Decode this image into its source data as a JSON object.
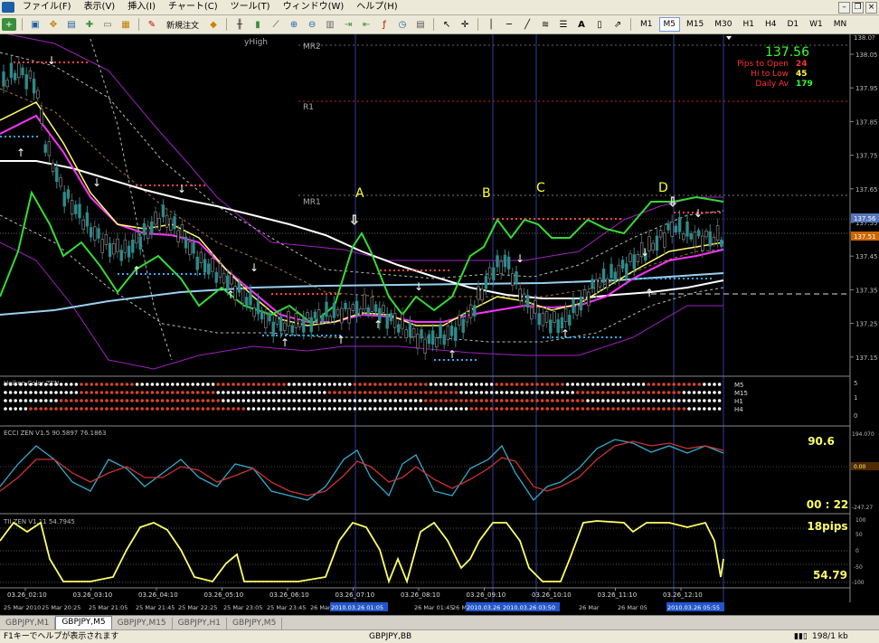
{
  "menu": [
    "ファイル(F)",
    "表示(V)",
    "挿入(I)",
    "チャート(C)",
    "ツール(T)",
    "ウィンドウ(W)",
    "ヘルプ(H)"
  ],
  "toolbar": {
    "new_order_label": "新規注文",
    "timeframes": [
      "M1",
      "M5",
      "M15",
      "M30",
      "H1",
      "H4",
      "D1",
      "W1",
      "MN"
    ],
    "active_timeframe": "M5"
  },
  "main_chart": {
    "yhigh_label": "yHigh",
    "level_labels": {
      "mr2": "MR2",
      "r1": "R1",
      "mr1": "MR1"
    },
    "markers": [
      "A",
      "B",
      "C",
      "D"
    ],
    "price_axis": [
      "138.05",
      "137.95",
      "137.85",
      "137.75",
      "137.65",
      "137.55",
      "137.45",
      "137.35",
      "137.25",
      "137.15"
    ],
    "price_top": "138.0?",
    "badges": {
      "bid": "137.56",
      "current": "137.51"
    },
    "info": {
      "price": "137.56",
      "rows": [
        {
          "label": "Pips to Open",
          "value": "24",
          "label_color": "#ff3333",
          "value_color": "#ff3333"
        },
        {
          "label": "Hi to Low",
          "value": "45",
          "label_color": "#ff3333",
          "value_color": "#ffff33"
        },
        {
          "label": "Daily Av",
          "value": "179",
          "label_color": "#ff3333",
          "value_color": "#33ff33"
        }
      ]
    }
  },
  "heiken": {
    "title": "Heiken Color ZEN",
    "rows": [
      "M5",
      "M15",
      "H1",
      "H4"
    ],
    "axis": [
      "5",
      "1",
      "0"
    ]
  },
  "ecci": {
    "title": "ECCI ZEN V1.5  90.5897 76.1863",
    "value": "90.6",
    "timer": "00 : 22",
    "axis_top": "194.070",
    "axis_mid": "0.00",
    "axis_bottom": "-247.27"
  },
  "tii": {
    "title": "TII ZEN V1.11  54.7945",
    "pips": "18pips",
    "value": "54.79",
    "axis": [
      "100",
      "50",
      "0",
      "-50",
      "-100"
    ]
  },
  "time_axis": {
    "upper": [
      "03.26_02:10",
      "03.26_03:10",
      "03.26_04:10",
      "03.26_05:10",
      "03.26_06:10",
      "03.26_07:10",
      "03.26_08:10",
      "03.26_09:10",
      "03.26_10:10",
      "03.26_11:10",
      "03.26_12:10"
    ],
    "lower": [
      "25 Mar 2010",
      "25 Mar 20:25",
      "25 Mar 21:05",
      "25 Mar 21:45",
      "25 Mar 22:25",
      "25 Mar 23:05",
      "25 Mar 23:45",
      "26 Mar",
      "2010.03.26 01:05",
      "26 Mar 01:45",
      "26 Mar",
      "2010.03.26 03:10",
      "2010.03.26 03:50",
      "26 Mar",
      "26 Mar 05",
      "2010.03.26 05:55"
    ]
  },
  "tabs": [
    "GBPJPY,M1",
    "GBPJPY,M5",
    "GBPJPY,M15",
    "GBPJPY,H1",
    "GBPJPY,M5"
  ],
  "active_tab": 1,
  "status": {
    "help": "F1キーでヘルプが表示されます",
    "profile": "GBPJPY,BB",
    "traffic": "198/1 kb"
  }
}
